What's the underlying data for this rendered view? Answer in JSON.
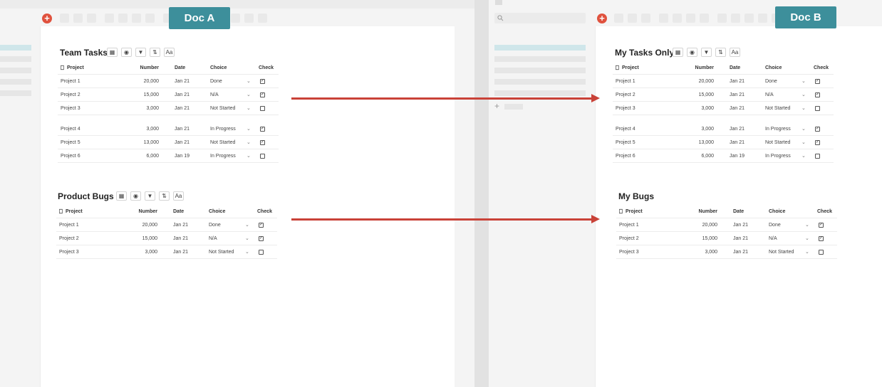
{
  "doc_a": {
    "tag": "Doc A",
    "tables": [
      {
        "title": "Team Tasks",
        "columns": [
          "Project",
          "Number",
          "Date",
          "Choice",
          "Check"
        ],
        "rows": [
          {
            "project": "Project 1",
            "number": "20,000",
            "date": "Jan 21",
            "choice": "Done",
            "checked": true
          },
          {
            "project": "Project 2",
            "number": "15,000",
            "date": "Jan 21",
            "choice": "N/A",
            "checked": true
          },
          {
            "project": "Project 3",
            "number": "3,000",
            "date": "Jan 21",
            "choice": "Not Started",
            "checked": false
          },
          {
            "project": "Project 4",
            "number": "3,000",
            "date": "Jan 21",
            "choice": "In Progress",
            "checked": true
          },
          {
            "project": "Project 5",
            "number": "13,000",
            "date": "Jan 21",
            "choice": "Not Started",
            "checked": true
          },
          {
            "project": "Project 6",
            "number": "6,000",
            "date": "Jan 19",
            "choice": "In Progress",
            "checked": false
          }
        ]
      },
      {
        "title": "Product Bugs",
        "columns": [
          "Project",
          "Number",
          "Date",
          "Choice",
          "Check"
        ],
        "rows": [
          {
            "project": "Project 1",
            "number": "20,000",
            "date": "Jan 21",
            "choice": "Done",
            "checked": true
          },
          {
            "project": "Project 2",
            "number": "15,000",
            "date": "Jan 21",
            "choice": "N/A",
            "checked": true
          },
          {
            "project": "Project 3",
            "number": "3,000",
            "date": "Jan 21",
            "choice": "Not Started",
            "checked": false
          }
        ]
      }
    ]
  },
  "doc_b": {
    "tag": "Doc B",
    "tables": [
      {
        "title": "My Tasks Only",
        "columns": [
          "Project",
          "Number",
          "Date",
          "Choice",
          "Check"
        ],
        "rows": [
          {
            "project": "Project 1",
            "number": "20,000",
            "date": "Jan 21",
            "choice": "Done",
            "checked": true
          },
          {
            "project": "Project 2",
            "number": "15,000",
            "date": "Jan 21",
            "choice": "N/A",
            "checked": true
          },
          {
            "project": "Project 3",
            "number": "3,000",
            "date": "Jan 21",
            "choice": "Not Started",
            "checked": false
          },
          {
            "project": "Project 4",
            "number": "3,000",
            "date": "Jan 21",
            "choice": "In Progress",
            "checked": true
          },
          {
            "project": "Project 5",
            "number": "13,000",
            "date": "Jan 21",
            "choice": "Not Started",
            "checked": true
          },
          {
            "project": "Project 6",
            "number": "6,000",
            "date": "Jan 19",
            "choice": "In Progress",
            "checked": false
          }
        ]
      },
      {
        "title": "My Bugs",
        "columns": [
          "Project",
          "Number",
          "Date",
          "Choice",
          "Check"
        ],
        "rows": [
          {
            "project": "Project 1",
            "number": "20,000",
            "date": "Jan 21",
            "choice": "Done",
            "checked": true
          },
          {
            "project": "Project 2",
            "number": "15,000",
            "date": "Jan 21",
            "choice": "N/A",
            "checked": true
          },
          {
            "project": "Project 3",
            "number": "3,000",
            "date": "Jan 21",
            "choice": "Not Started",
            "checked": false
          }
        ]
      }
    ]
  },
  "icons": {
    "add": "plus-circle-icon",
    "search": "search-icon",
    "bookmark": "bookmark-icon",
    "table": "table-icon",
    "eye": "eye-icon",
    "filter": "filter-icon",
    "sort": "sort-icon",
    "text": "text-format-icon",
    "chevron": "chevron-down-icon",
    "checkbox": "checkbox-icon"
  },
  "colors": {
    "doc_tag": "#3d8f9b",
    "arrow": "#c94238",
    "add_button": "#e0523e",
    "sidebar_highlight": "#cfe6ea"
  }
}
